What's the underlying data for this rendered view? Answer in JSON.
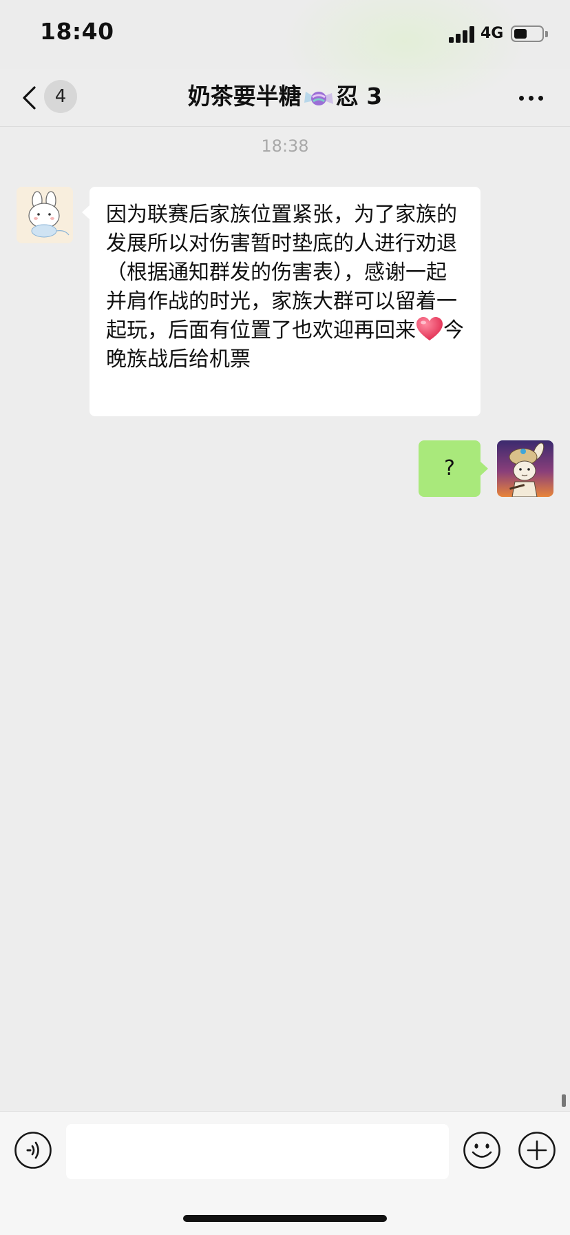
{
  "status_bar": {
    "time": "18:40",
    "network": "4G",
    "battery_level": 0.45
  },
  "nav": {
    "unread_count": "4",
    "title_before": "奶茶要半糖",
    "title_after": "忍 3",
    "title_icon": "candy-icon"
  },
  "messages": {
    "timestamp": "18:38",
    "received_text_part1": "因为联赛后家族位置紧张，为了家族的发展所以对伤害暂时垫底的人进行劝退（根据通知群发的伤害表），感谢一起并肩作战的时光，家族大群可以留着一起玩，后面有位置了也欢迎再回来",
    "received_emoji": "heart-icon",
    "received_text_part2": "今晚族战后给机票",
    "sent_text": "?"
  },
  "input": {
    "value": "",
    "placeholder": ""
  },
  "colors": {
    "background": "#EDEDED",
    "received_bubble": "#FFFFFF",
    "sent_bubble": "#A9E97B",
    "timestamp": "#A9A9A9",
    "input_bar": "#F6F6F6"
  }
}
